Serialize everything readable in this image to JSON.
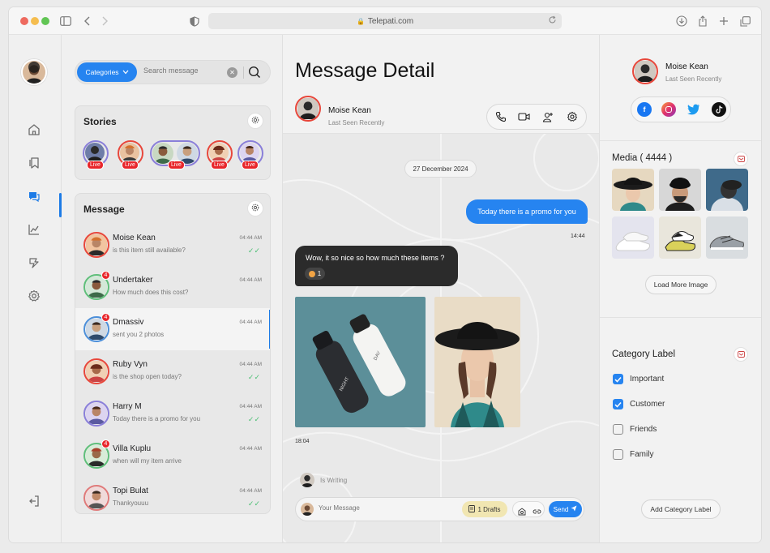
{
  "browser": {
    "url": "Telepati.com"
  },
  "search": {
    "category_label": "Categories",
    "placeholder": "Search message"
  },
  "stories": {
    "title": "Stories",
    "items": [
      {
        "live_label": "Live"
      },
      {
        "live_label": "Live"
      },
      {
        "live_label": "Live"
      },
      {
        "live_label": "Live"
      },
      {
        "live_label": "Live"
      }
    ]
  },
  "messages": {
    "title": "Message",
    "items": [
      {
        "name": "Moise Kean",
        "preview": "is this item still available?",
        "time": "04:44 AM",
        "read": true,
        "unread": ""
      },
      {
        "name": "Undertaker",
        "preview": "How much does this cost?",
        "time": "04:44 AM",
        "read": false,
        "unread": "4"
      },
      {
        "name": "Dmassiv",
        "preview": "sent you 2 photos",
        "time": "04:44 AM",
        "read": false,
        "unread": "4"
      },
      {
        "name": "Ruby Vyn",
        "preview": "is the shop open today?",
        "time": "04:44 AM",
        "read": true,
        "unread": ""
      },
      {
        "name": "Harry M",
        "preview": "Today there is a promo for you",
        "time": "04:44 AM",
        "read": true,
        "unread": ""
      },
      {
        "name": "Villa Kuplu",
        "preview": "when will my item arrive",
        "time": "04:44 AM",
        "read": false,
        "unread": "4"
      },
      {
        "name": "Topi Bulat",
        "preview": "Thankyouuu",
        "time": "04:44 AM",
        "read": true,
        "unread": ""
      }
    ]
  },
  "detail": {
    "title": "Message Detail",
    "contact_name": "Moise Kean",
    "contact_status": "Last Seen Recently",
    "date_chip": "27 December 2024",
    "outgoing_text": "Today there is a promo for you",
    "outgoing_time": "14:44",
    "incoming_text": "Wow, it so nice so how much these items ?",
    "reaction_count": "1",
    "photo_time": "18:04",
    "bottle_label_1": "NIGHT",
    "bottle_label_2": "DAY",
    "typing_text": "Is Writing",
    "composer_placeholder": "Your Message",
    "drafts_label": "1 Drafts",
    "send_label": "Send"
  },
  "profile": {
    "name": "Moise Kean",
    "status": "Last Seen Recently"
  },
  "media": {
    "title": "Media ( 4444 )",
    "load_more": "Load More Image"
  },
  "categories": {
    "title": "Category Label",
    "items": [
      {
        "label": "Important",
        "checked": true
      },
      {
        "label": "Customer",
        "checked": true
      },
      {
        "label": "Friends",
        "checked": false
      },
      {
        "label": "Family",
        "checked": false
      }
    ],
    "add_label": "Add Category Label"
  },
  "colors": {
    "accent": "#2684f0",
    "live": "#e8262b",
    "read_tick": "#4bbf73",
    "dark_bubble": "#2b2b2b"
  }
}
